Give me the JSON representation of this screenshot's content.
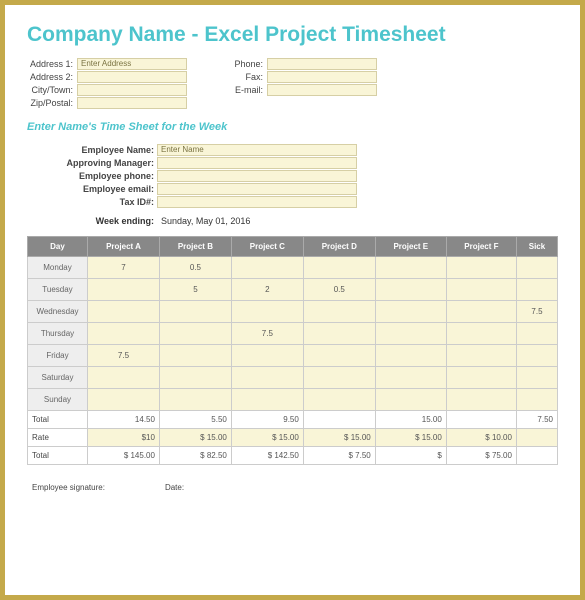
{
  "title": "Company Name - Excel Project Timesheet",
  "address": {
    "left": [
      {
        "label": "Address 1:",
        "value": "Enter Address"
      },
      {
        "label": "Address 2:",
        "value": ""
      },
      {
        "label": "City/Town:",
        "value": ""
      },
      {
        "label": "Zip/Postal:",
        "value": ""
      }
    ],
    "right": [
      {
        "label": "Phone:",
        "value": ""
      },
      {
        "label": "Fax:",
        "value": ""
      },
      {
        "label": "E-mail:",
        "value": ""
      }
    ]
  },
  "subtitle": "Enter Name's Time Sheet for the Week",
  "employee": [
    {
      "label": "Employee Name:",
      "value": "Enter Name"
    },
    {
      "label": "Approving Manager:",
      "value": ""
    },
    {
      "label": "Employee phone:",
      "value": ""
    },
    {
      "label": "Employee email:",
      "value": ""
    },
    {
      "label": "Tax ID#:",
      "value": ""
    }
  ],
  "week_ending_label": "Week ending:",
  "week_ending_value": "Sunday, May 01, 2016",
  "headers": [
    "Day",
    "Project A",
    "Project B",
    "Project C",
    "Project D",
    "Project E",
    "Project F",
    "Sick"
  ],
  "days": [
    {
      "name": "Monday",
      "v": [
        "7",
        "0.5",
        "",
        "",
        "",
        "",
        ""
      ]
    },
    {
      "name": "Tuesday",
      "v": [
        "",
        "5",
        "2",
        "0.5",
        "",
        "",
        ""
      ]
    },
    {
      "name": "Wednesday",
      "v": [
        "",
        "",
        "",
        "",
        "",
        "",
        "7.5"
      ]
    },
    {
      "name": "Thursday",
      "v": [
        "",
        "",
        "7.5",
        "",
        "",
        "",
        ""
      ]
    },
    {
      "name": "Friday",
      "v": [
        "7.5",
        "",
        "",
        "",
        "",
        "",
        ""
      ]
    },
    {
      "name": "Saturday",
      "v": [
        "",
        "",
        "",
        "",
        "",
        "",
        ""
      ]
    },
    {
      "name": "Sunday",
      "v": [
        "",
        "",
        "",
        "",
        "",
        "",
        ""
      ]
    }
  ],
  "totals_label": "Total",
  "totals": [
    "14.50",
    "5.50",
    "9.50",
    "",
    "15.00",
    "",
    "7.50"
  ],
  "rate_label": "Rate",
  "rate": [
    "$10",
    "$  15.00",
    "$  15.00",
    "$  15.00",
    "$  15.00",
    "$  10.00",
    ""
  ],
  "gtotals_label": "Total",
  "gtotals": [
    "$  145.00",
    "$  82.50",
    "$  142.50",
    "$  7.50",
    "$",
    "$  75.00",
    ""
  ],
  "sig": {
    "emp": "Employee signature:",
    "date": "Date:"
  }
}
